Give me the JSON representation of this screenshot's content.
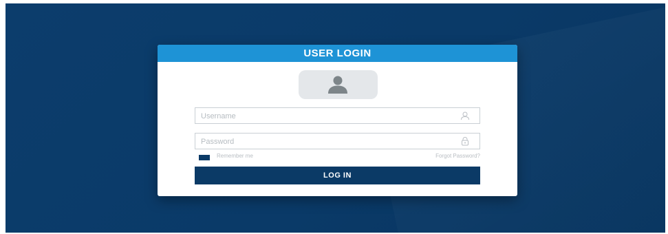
{
  "login": {
    "title": "USER LOGIN",
    "username": {
      "placeholder": "Username",
      "value": ""
    },
    "password": {
      "placeholder": "Password",
      "value": ""
    },
    "remember_label": "Remember me",
    "remember_checked": true,
    "forgot_label": "Forgot Password?",
    "submit_label": "LOG IN"
  },
  "icons": {
    "avatar": "user-silhouette-icon",
    "username": "user-outline-icon",
    "password": "lock-outline-icon"
  },
  "colors": {
    "background": "#0a3a68",
    "header": "#1e93d6",
    "button": "#0b3a66",
    "avatar_bg": "#e4e7ea",
    "field_border": "#c9cfd4"
  }
}
